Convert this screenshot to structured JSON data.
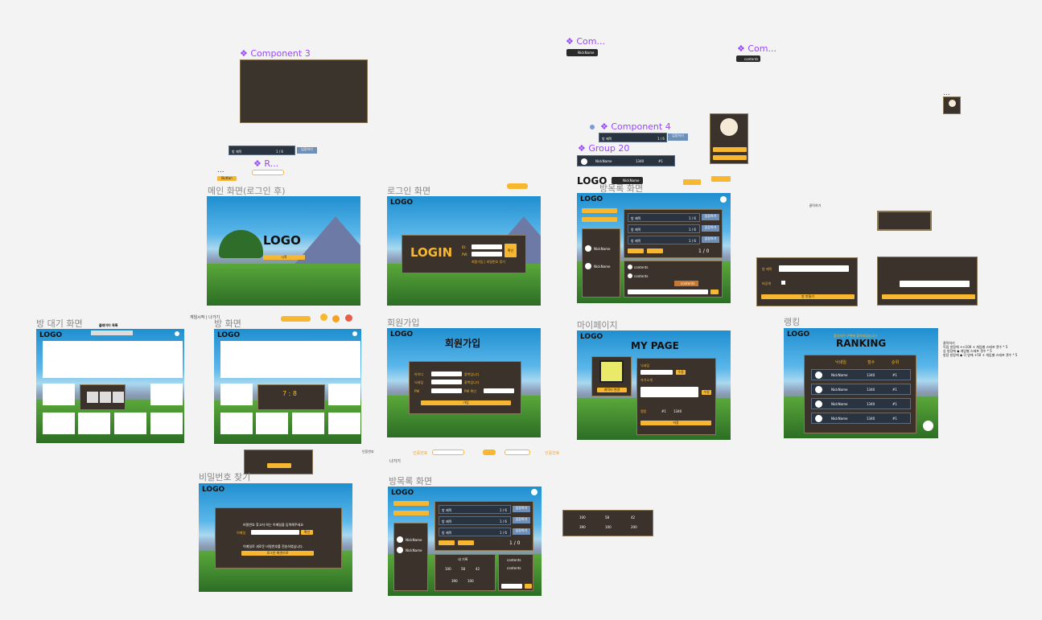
{
  "components": {
    "comp3": "❖ Component 3",
    "comp_nick": "❖ Com...",
    "comp_contents": "❖ Com...",
    "comp4": "❖ Component 4",
    "group20": "❖ Group 20",
    "room_item": "❖ R...",
    "nickname_tag": "NickName",
    "contents_tag": "contents",
    "button_tag": "Button",
    "dots": "..."
  },
  "frame_labels": {
    "main": "메인 화면(로그인 후)",
    "login": "로그인 화면",
    "room_list": "방목록 화면",
    "waiting": "방 대기 화면",
    "room": "방 화면",
    "signup": "회원가입",
    "mypage": "마이페이지",
    "ranking": "랭킹",
    "find_pw": "비밀번호 찾기",
    "guestbook": "방목록 화면"
  },
  "common": {
    "logo": "LOGO",
    "big_logo": "LOGO",
    "room_title": "방 제목",
    "room_count": "1 / 6",
    "enter": "입장하기",
    "nickname": "NickName",
    "score": "1340",
    "rank": "#1",
    "contents": "contents",
    "page": "1 / 0"
  },
  "login": {
    "title": "LOGIN",
    "id": "ID:",
    "pw": "PW:",
    "confirm": "확인",
    "links": "회원가입 | 비밀번호 찾기"
  },
  "signup": {
    "title": "회원가입",
    "id": "아이디",
    "nick": "닉네임",
    "pw": "PW",
    "pw_check": "PW 확인",
    "dup1": "중복입니다",
    "dup2": "중복입니다",
    "submit": "가입"
  },
  "mypage": {
    "title": "MY PAGE",
    "nick_label": "닉네임",
    "intro_label": "자기소개",
    "change": "수정",
    "rank_label": "랭킹",
    "change_pw": "비번 변경",
    "save": "저장",
    "char_change": "캐릭터 변경"
  },
  "ranking": {
    "title": "RANKING",
    "subtitle": "플다이기 우편에 좋아되었습니다",
    "col_nick": "닉네임",
    "col_score": "점수",
    "col_rank": "순위",
    "note1": "클릭하기",
    "note2": "득점 방장에 ++100 + 게임별 스테프 갯수 * 5",
    "note3": "승 방장에 ◆ 게임별 스테프 갯수 * 5",
    "note4": "방장 방장에 ◆ 각 방에 +50 + 게임별 스테프 갯수 * 5"
  },
  "room": {
    "score": "7 : 8",
    "waiting_title": "플레이어 목록",
    "start": "게임시작 | 나가기",
    "exit": "나가기"
  },
  "find_pw": {
    "line1": "비밀번호 찾고자 하는 이메일을 입력해주세요",
    "email": "이메일",
    "send": "확인",
    "line2": "이메일로 새로운 비밀번호를 전송하였습니다.",
    "back": "로그인 화면으로"
  },
  "guestbook": {
    "my_record": "내 기록",
    "wins": "100",
    "losses": "58",
    "draws": "42",
    "total": "390",
    "rate": "100",
    "streak": "200"
  },
  "misc": {
    "code_label": "인증번호",
    "code_label2": "인증번호",
    "start_btn": "시작",
    "modal_create": "방 만들기",
    "modal_private": "비공개",
    "modal_title": "방 제목"
  }
}
